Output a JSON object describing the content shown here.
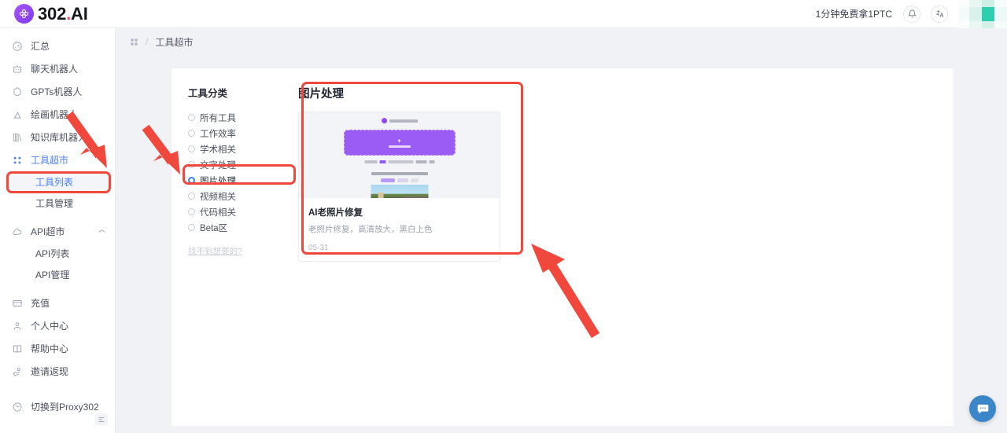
{
  "topbar": {
    "brand_prefix": "302",
    "brand_dot": ".",
    "brand_suffix": "AI",
    "promo": "1分钟免费拿1PTC",
    "bell_icon": "bell-icon",
    "language_icon": "translate-icon",
    "avatar": "user-avatar"
  },
  "sidebar": {
    "items": [
      {
        "label": "汇总",
        "icon": "dashboard-icon"
      },
      {
        "label": "聊天机器人",
        "icon": "robot-icon"
      },
      {
        "label": "GPTs机器人",
        "icon": "gpt-icon"
      },
      {
        "label": "绘画机器人",
        "icon": "paint-icon"
      },
      {
        "label": "知识库机器人",
        "icon": "knowledge-icon"
      },
      {
        "label": "工具超市",
        "icon": "grid-icon",
        "active": true,
        "chevron": "⌃"
      },
      {
        "label": "API超市",
        "icon": "cloud-icon",
        "chevron": "⌃"
      },
      {
        "label": "充值",
        "icon": "card-icon"
      },
      {
        "label": "个人中心",
        "icon": "user-icon"
      },
      {
        "label": "帮助中心",
        "icon": "book-icon"
      },
      {
        "label": "邀请返现",
        "icon": "hand-coin-icon"
      },
      {
        "label": "切换到Proxy302",
        "icon": "proxy-icon"
      }
    ],
    "tool_sub": [
      {
        "label": "工具列表",
        "selected": true
      },
      {
        "label": "工具管理",
        "selected": false
      }
    ],
    "api_sub": [
      {
        "label": "API列表",
        "selected": false
      },
      {
        "label": "API管理",
        "selected": false
      }
    ],
    "collapse_icon": "collapse-sidebar-icon"
  },
  "breadcrumb": {
    "home_icon": "grid-icon",
    "separator": "/",
    "current": "工具超市"
  },
  "categories": {
    "title": "工具分类",
    "options": [
      {
        "label": "所有工具",
        "checked": false
      },
      {
        "label": "工作效率",
        "checked": false
      },
      {
        "label": "学术相关",
        "checked": false
      },
      {
        "label": "文字处理",
        "checked": false
      },
      {
        "label": "图片处理",
        "checked": true
      },
      {
        "label": "视频相关",
        "checked": false
      },
      {
        "label": "代码相关",
        "checked": false
      },
      {
        "label": "Beta区",
        "checked": false
      }
    ],
    "not_found_link": "找不到想要的?"
  },
  "results": {
    "section_title": "图片处理",
    "cards": [
      {
        "title": "AI老照片修复",
        "description": "老照片修复，高清放大，黑白上色",
        "date": "05-31",
        "thumbnail": "tool-preview-thumbnail"
      }
    ]
  },
  "chat": {
    "icon": "chat-bubble-icon"
  },
  "annotations": {
    "highlight_color": "#f0483c",
    "boxes": [
      "工具列表",
      "图片处理",
      "图片处理卡片区"
    ],
    "arrows": [
      "arrow-to-tool-list",
      "arrow-to-image-category",
      "arrow-to-tool-card"
    ]
  }
}
